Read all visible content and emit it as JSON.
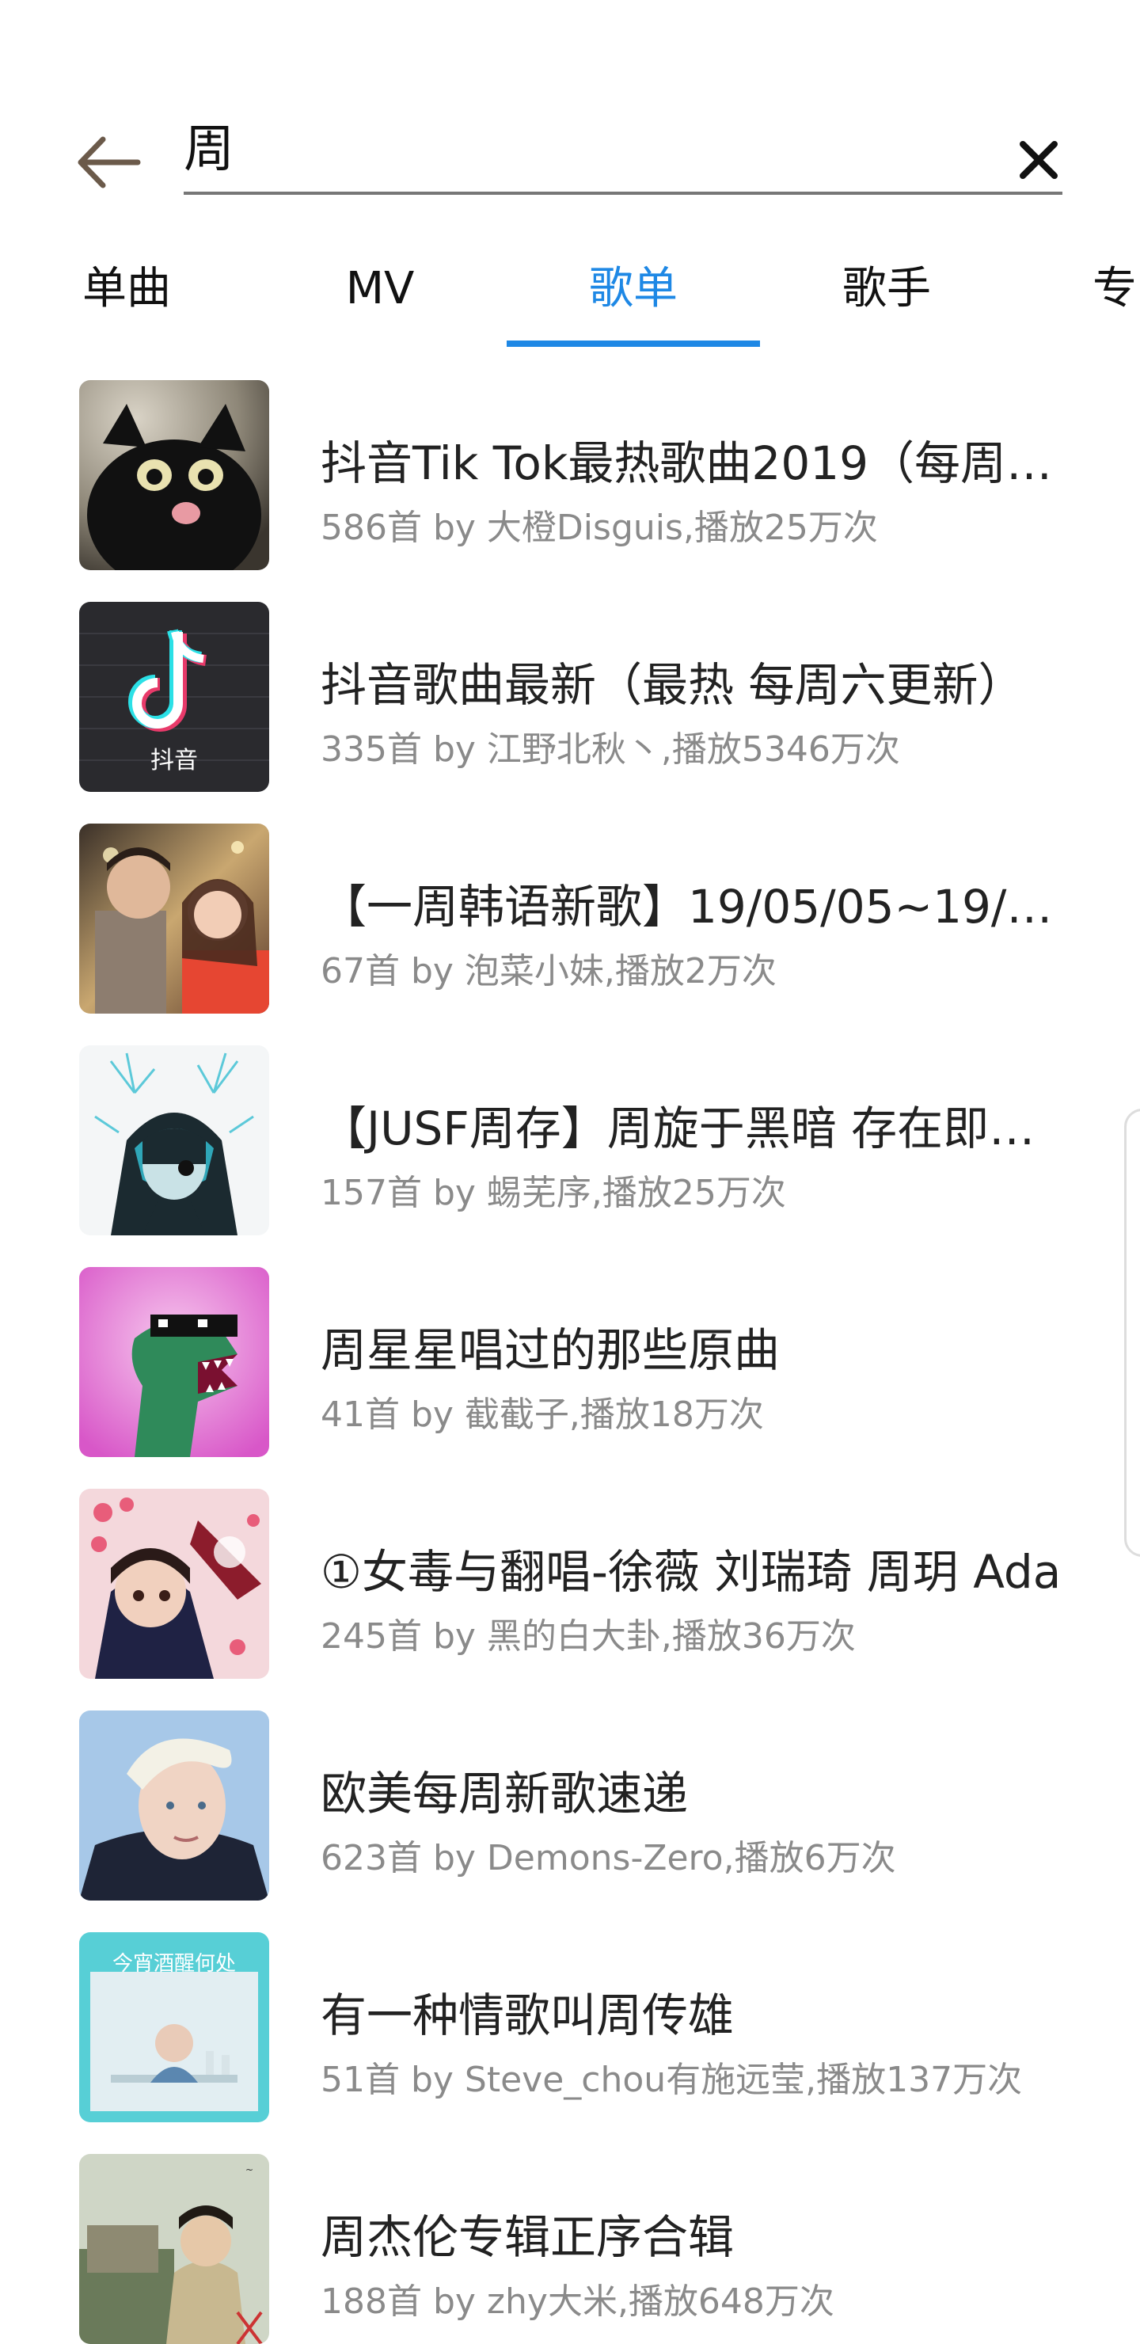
{
  "search": {
    "query": "周"
  },
  "tabs": [
    {
      "label": "单曲"
    },
    {
      "label": "MV"
    },
    {
      "label": "歌单"
    },
    {
      "label": "歌手"
    },
    {
      "label": "专"
    }
  ],
  "active_tab": "歌单",
  "accent_color": "#1e88e5",
  "playlists": [
    {
      "title": "抖音Tik Tok最热歌曲2019（每周…",
      "subtitle": "586首 by 大橙Disguis,播放25万次"
    },
    {
      "title": "抖音歌曲最新（最热 每周六更新）",
      "subtitle": "335首 by 江野北秋丶,播放5346万次"
    },
    {
      "title": "【一周韩语新歌】19/05/05~19/…",
      "subtitle": "67首 by 泡菜小妹,播放2万次"
    },
    {
      "title": "【JUSF周存】周旋于黑暗 存在即…",
      "subtitle": "157首 by 蜴芜序,播放25万次"
    },
    {
      "title": "周星星唱过的那些原曲",
      "subtitle": "41首 by 截截子,播放18万次"
    },
    {
      "title": "①女毒与翻唱-徐薇 刘瑞琦 周玥 Ada",
      "subtitle": "245首 by 黑的白大卦,播放36万次"
    },
    {
      "title": "欧美每周新歌速递",
      "subtitle": "623首 by Demons-Zero,播放6万次"
    },
    {
      "title": "有一种情歌叫周传雄",
      "subtitle": "51首 by Steve_chou有施远莹,播放137万次"
    },
    {
      "title": "周杰伦专辑正序合辑",
      "subtitle": "188首 by zhy大米,播放648万次"
    }
  ],
  "cover_art": [
    "抖音",
    "今宵酒醒何处"
  ]
}
